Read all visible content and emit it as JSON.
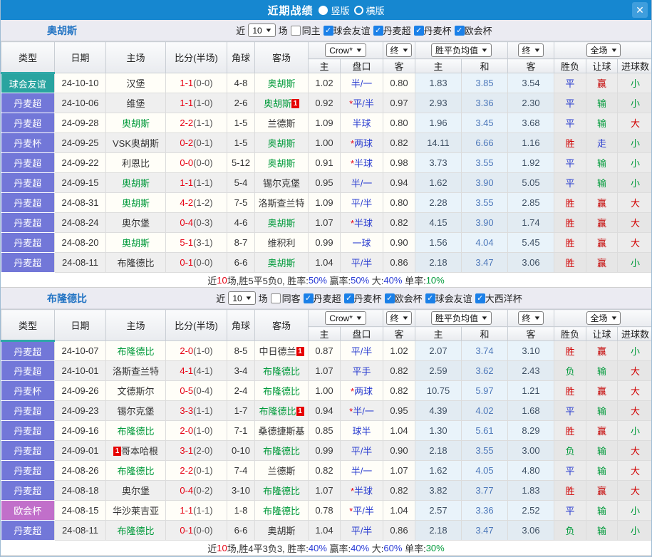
{
  "titlebar": {
    "title": "近期战绩",
    "options": [
      {
        "label": "竖版",
        "selected": true
      },
      {
        "label": "横版",
        "selected": false
      }
    ],
    "close_label": "✕"
  },
  "type_colors": {
    "球会友谊": "#29a4a0",
    "丹麦超": "#7277d8",
    "丹麦杯": "#7277d8",
    "欧会杯": "#c16fca",
    "大西洋杯": "#29a4a0"
  },
  "result_colors": {
    "胜": "#d10000",
    "平": "#2a3dd0",
    "负": "#009a3a",
    "赢": "#c40000",
    "输": "#009a3a",
    "走": "#2a3dd0",
    "大": "#d10000",
    "小": "#009a3a"
  },
  "table_header": {
    "cols": [
      "类型",
      "日期",
      "主场",
      "比分(半场)",
      "角球",
      "客场"
    ],
    "sub": [
      "主",
      "盘口",
      "客",
      "主",
      "和",
      "客",
      "胜负",
      "让球",
      "进球数"
    ],
    "selects": [
      "Crow*",
      "终",
      "胜平负均值",
      "终",
      "全场"
    ]
  },
  "sections": [
    {
      "team": "奥胡斯",
      "filters": {
        "near": "近",
        "count": "10",
        "games": "场",
        "same": {
          "label": "同主",
          "checked": false
        },
        "leagues": [
          {
            "label": "球会友谊",
            "checked": true
          },
          {
            "label": "丹麦超",
            "checked": true
          },
          {
            "label": "丹麦杯",
            "checked": true
          },
          {
            "label": "欧会杯",
            "checked": true
          }
        ]
      },
      "rows": [
        {
          "type": "球会友谊",
          "date": "24-10-10",
          "home": {
            "name": "汉堡"
          },
          "score": "1-1",
          "half": "(0-0)",
          "corner": "4-8",
          "away": {
            "name": "奥胡斯",
            "focus": true
          },
          "odds": [
            "1.02",
            "半/一",
            "0.80"
          ],
          "avg": [
            "1.83",
            "3.85",
            "3.54"
          ],
          "res": [
            "平",
            "赢",
            "小"
          ]
        },
        {
          "type": "丹麦超",
          "date": "24-10-06",
          "home": {
            "name": "维堡"
          },
          "score": "1-1",
          "half": "(1-0)",
          "corner": "2-6",
          "away": {
            "name": "奥胡斯",
            "focus": true,
            "badge": "1",
            "badge_pos": "after"
          },
          "odds": [
            "0.92",
            "*平/半",
            "0.97"
          ],
          "avg": [
            "2.93",
            "3.36",
            "2.30"
          ],
          "res": [
            "平",
            "输",
            "小"
          ]
        },
        {
          "type": "丹麦超",
          "date": "24-09-28",
          "home": {
            "name": "奥胡斯",
            "focus": true
          },
          "score": "2-2",
          "half": "(1-1)",
          "corner": "1-5",
          "away": {
            "name": "兰德斯"
          },
          "odds": [
            "1.09",
            "半球",
            "0.80"
          ],
          "avg": [
            "1.96",
            "3.45",
            "3.68"
          ],
          "res": [
            "平",
            "输",
            "大"
          ]
        },
        {
          "type": "丹麦杯",
          "date": "24-09-25",
          "home": {
            "name": "VSK奥胡斯"
          },
          "score": "0-2",
          "half": "(0-1)",
          "corner": "1-5",
          "away": {
            "name": "奥胡斯",
            "focus": true
          },
          "odds": [
            "1.00",
            "*两球",
            "0.82"
          ],
          "avg": [
            "14.11",
            "6.66",
            "1.16"
          ],
          "res": [
            "胜",
            "走",
            "小"
          ]
        },
        {
          "type": "丹麦超",
          "date": "24-09-22",
          "home": {
            "name": "利恩比"
          },
          "score": "0-0",
          "half": "(0-0)",
          "corner": "5-12",
          "away": {
            "name": "奥胡斯",
            "focus": true
          },
          "odds": [
            "0.91",
            "*半球",
            "0.98"
          ],
          "avg": [
            "3.73",
            "3.55",
            "1.92"
          ],
          "res": [
            "平",
            "输",
            "小"
          ]
        },
        {
          "type": "丹麦超",
          "date": "24-09-15",
          "home": {
            "name": "奥胡斯",
            "focus": true
          },
          "score": "1-1",
          "half": "(1-1)",
          "corner": "5-4",
          "away": {
            "name": "锡尔克堡"
          },
          "odds": [
            "0.95",
            "半/一",
            "0.94"
          ],
          "avg": [
            "1.62",
            "3.90",
            "5.05"
          ],
          "res": [
            "平",
            "输",
            "小"
          ]
        },
        {
          "type": "丹麦超",
          "date": "24-08-31",
          "home": {
            "name": "奥胡斯",
            "focus": true
          },
          "score": "4-2",
          "half": "(1-2)",
          "corner": "7-5",
          "away": {
            "name": "洛斯查兰特"
          },
          "odds": [
            "1.09",
            "平/半",
            "0.80"
          ],
          "avg": [
            "2.28",
            "3.55",
            "2.85"
          ],
          "res": [
            "胜",
            "赢",
            "大"
          ]
        },
        {
          "type": "丹麦超",
          "date": "24-08-24",
          "home": {
            "name": "奥尔堡"
          },
          "score": "0-4",
          "half": "(0-3)",
          "corner": "4-6",
          "away": {
            "name": "奥胡斯",
            "focus": true
          },
          "odds": [
            "1.07",
            "*半球",
            "0.82"
          ],
          "avg": [
            "4.15",
            "3.90",
            "1.74"
          ],
          "res": [
            "胜",
            "赢",
            "大"
          ]
        },
        {
          "type": "丹麦超",
          "date": "24-08-20",
          "home": {
            "name": "奥胡斯",
            "focus": true
          },
          "score": "5-1",
          "half": "(3-1)",
          "corner": "8-7",
          "away": {
            "name": "维积利"
          },
          "odds": [
            "0.99",
            "一球",
            "0.90"
          ],
          "avg": [
            "1.56",
            "4.04",
            "5.45"
          ],
          "res": [
            "胜",
            "赢",
            "大"
          ]
        },
        {
          "type": "丹麦超",
          "date": "24-08-11",
          "home": {
            "name": "布隆德比"
          },
          "score": "0-1",
          "half": "(0-0)",
          "corner": "6-6",
          "away": {
            "name": "奥胡斯",
            "focus": true
          },
          "odds": [
            "1.04",
            "平/半",
            "0.86"
          ],
          "avg": [
            "2.18",
            "3.47",
            "3.06"
          ],
          "res": [
            "胜",
            "赢",
            "小"
          ]
        }
      ],
      "summary": [
        {
          "t": "近",
          "c": "#333333"
        },
        {
          "t": "10",
          "c": "#e60012"
        },
        {
          "t": "场,胜5平5负0, 胜率:",
          "c": "#333333"
        },
        {
          "t": "50%",
          "c": "#2a3cd6"
        },
        {
          "t": " 赢率:",
          "c": "#333333"
        },
        {
          "t": "50%",
          "c": "#2a3cd6"
        },
        {
          "t": " 大:",
          "c": "#333333"
        },
        {
          "t": "40%",
          "c": "#2a3cd6"
        },
        {
          "t": " 单率:",
          "c": "#333333"
        },
        {
          "t": "10%",
          "c": "#009a3a"
        }
      ]
    },
    {
      "team": "布隆德比",
      "filters": {
        "near": "近",
        "count": "10",
        "games": "场",
        "same": {
          "label": "同客",
          "checked": false
        },
        "leagues": [
          {
            "label": "丹麦超",
            "checked": true
          },
          {
            "label": "丹麦杯",
            "checked": true
          },
          {
            "label": "欧会杯",
            "checked": true
          },
          {
            "label": "球会友谊",
            "checked": true
          },
          {
            "label": "大西洋杯",
            "checked": true
          }
        ]
      },
      "rows": [
        {
          "type": "丹麦超",
          "date": "24-10-07",
          "home": {
            "name": "布隆德比",
            "focus": true
          },
          "score": "2-0",
          "half": "(1-0)",
          "corner": "8-5",
          "away": {
            "name": "中日德兰",
            "badge": "1",
            "badge_pos": "after"
          },
          "odds": [
            "0.87",
            "平/半",
            "1.02"
          ],
          "avg": [
            "2.07",
            "3.74",
            "3.10"
          ],
          "res": [
            "胜",
            "赢",
            "小"
          ]
        },
        {
          "type": "丹麦超",
          "date": "24-10-01",
          "home": {
            "name": "洛斯查兰特"
          },
          "score": "4-1",
          "half": "(4-1)",
          "corner": "3-4",
          "away": {
            "name": "布隆德比",
            "focus": true
          },
          "odds": [
            "1.07",
            "平手",
            "0.82"
          ],
          "avg": [
            "2.59",
            "3.62",
            "2.43"
          ],
          "res": [
            "负",
            "输",
            "大"
          ]
        },
        {
          "type": "丹麦杯",
          "date": "24-09-26",
          "home": {
            "name": "文德斯尔"
          },
          "score": "0-5",
          "half": "(0-4)",
          "corner": "2-4",
          "away": {
            "name": "布隆德比",
            "focus": true
          },
          "odds": [
            "1.00",
            "*两球",
            "0.82"
          ],
          "avg": [
            "10.75",
            "5.97",
            "1.21"
          ],
          "res": [
            "胜",
            "赢",
            "大"
          ]
        },
        {
          "type": "丹麦超",
          "date": "24-09-23",
          "home": {
            "name": "锡尔克堡"
          },
          "score": "3-3",
          "half": "(1-1)",
          "corner": "1-7",
          "away": {
            "name": "布隆德比",
            "focus": true,
            "badge": "1",
            "badge_pos": "after"
          },
          "odds": [
            "0.94",
            "*半/一",
            "0.95"
          ],
          "avg": [
            "4.39",
            "4.02",
            "1.68"
          ],
          "res": [
            "平",
            "输",
            "大"
          ]
        },
        {
          "type": "丹麦超",
          "date": "24-09-16",
          "home": {
            "name": "布隆德比",
            "focus": true
          },
          "score": "2-0",
          "half": "(1-0)",
          "corner": "7-1",
          "away": {
            "name": "桑德捷斯基"
          },
          "odds": [
            "0.85",
            "球半",
            "1.04"
          ],
          "avg": [
            "1.30",
            "5.61",
            "8.29"
          ],
          "res": [
            "胜",
            "赢",
            "小"
          ]
        },
        {
          "type": "丹麦超",
          "date": "24-09-01",
          "home": {
            "name": "哥本哈根",
            "badge": "1",
            "badge_pos": "before"
          },
          "score": "3-1",
          "half": "(2-0)",
          "corner": "0-10",
          "away": {
            "name": "布隆德比",
            "focus": true
          },
          "odds": [
            "0.99",
            "平/半",
            "0.90"
          ],
          "avg": [
            "2.18",
            "3.55",
            "3.00"
          ],
          "res": [
            "负",
            "输",
            "大"
          ]
        },
        {
          "type": "丹麦超",
          "date": "24-08-26",
          "home": {
            "name": "布隆德比",
            "focus": true
          },
          "score": "2-2",
          "half": "(0-1)",
          "corner": "7-4",
          "away": {
            "name": "兰德斯"
          },
          "odds": [
            "0.82",
            "半/一",
            "1.07"
          ],
          "avg": [
            "1.62",
            "4.05",
            "4.80"
          ],
          "res": [
            "平",
            "输",
            "大"
          ]
        },
        {
          "type": "丹麦超",
          "date": "24-08-18",
          "home": {
            "name": "奥尔堡"
          },
          "score": "0-4",
          "half": "(0-2)",
          "corner": "3-10",
          "away": {
            "name": "布隆德比",
            "focus": true
          },
          "odds": [
            "1.07",
            "*半球",
            "0.82"
          ],
          "avg": [
            "3.82",
            "3.77",
            "1.83"
          ],
          "res": [
            "胜",
            "赢",
            "大"
          ]
        },
        {
          "type": "欧会杯",
          "date": "24-08-15",
          "home": {
            "name": "华沙莱吉亚"
          },
          "score": "1-1",
          "half": "(1-1)",
          "corner": "1-8",
          "away": {
            "name": "布隆德比",
            "focus": true
          },
          "odds": [
            "0.78",
            "*平/半",
            "1.04"
          ],
          "avg": [
            "2.57",
            "3.36",
            "2.52"
          ],
          "res": [
            "平",
            "输",
            "小"
          ]
        },
        {
          "type": "丹麦超",
          "date": "24-08-11",
          "home": {
            "name": "布隆德比",
            "focus": true
          },
          "score": "0-1",
          "half": "(0-0)",
          "corner": "6-6",
          "away": {
            "name": "奥胡斯"
          },
          "odds": [
            "1.04",
            "平/半",
            "0.86"
          ],
          "avg": [
            "2.18",
            "3.47",
            "3.06"
          ],
          "res": [
            "负",
            "输",
            "小"
          ]
        }
      ],
      "summary": [
        {
          "t": "近",
          "c": "#333333"
        },
        {
          "t": "10",
          "c": "#e60012"
        },
        {
          "t": "场,胜4平3负3, 胜率:",
          "c": "#333333"
        },
        {
          "t": "40%",
          "c": "#2a3cd6"
        },
        {
          "t": " 赢率:",
          "c": "#333333"
        },
        {
          "t": "40%",
          "c": "#2a3cd6"
        },
        {
          "t": " 大:",
          "c": "#333333"
        },
        {
          "t": "60%",
          "c": "#2a3cd6"
        },
        {
          "t": " 单率:",
          "c": "#333333"
        },
        {
          "t": "30%",
          "c": "#009a3a"
        }
      ]
    }
  ]
}
